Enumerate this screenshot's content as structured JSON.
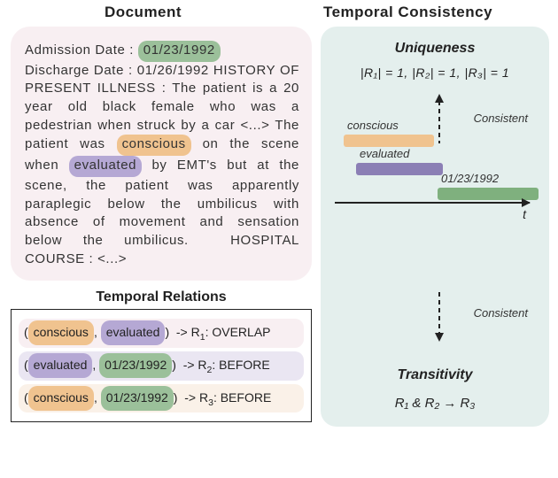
{
  "header": {
    "document": "Document",
    "consistency": "Temporal Consistency"
  },
  "doc": {
    "pre1": "Admission Date : ",
    "admission_date": "01/23/1992",
    "line2a": "Discharge Date : ",
    "line2b": "01/26/1992",
    "para_a": "HISTORY OF PRESENT ILLNESS : The patient is a 20 year old black female who was a pedestrian when struck by a car <...> The patient was ",
    "conscious": "conscious",
    "para_b": " on the scene when ",
    "evaluated": "evaluated",
    "para_c": " by EMT's but at the scene, the patient was apparently paraplegic below the umbilicus with absence of movement and sensation below the umbilicus.  HOSPITAL COURSE : <...>"
  },
  "relations": {
    "title": "Temporal Relations",
    "rows": [
      {
        "a": "conscious",
        "b": "evaluated",
        "r": "R",
        "i": "1",
        "label": "OVERLAP"
      },
      {
        "a": "evaluated",
        "b": "01/23/1992",
        "r": "R",
        "i": "2",
        "label": "BEFORE"
      },
      {
        "a": "conscious",
        "b": "01/23/1992",
        "r": "R",
        "i": "3",
        "label": "BEFORE"
      }
    ]
  },
  "consistency": {
    "uniqueness_title": "Uniqueness",
    "uniqueness_formula": "|R₁| = 1, |R₂| = 1, |R₃| = 1",
    "consistent_label_top": "Consistent",
    "consistent_label_bottom": "Consistent",
    "transitivity_title": "Transitivity",
    "transitivity_formula": "R₁ & R₂ → R₃",
    "t_label": "t",
    "bars": {
      "conscious": "conscious",
      "evaluated": "evaluated",
      "date": "01/23/1992"
    }
  }
}
